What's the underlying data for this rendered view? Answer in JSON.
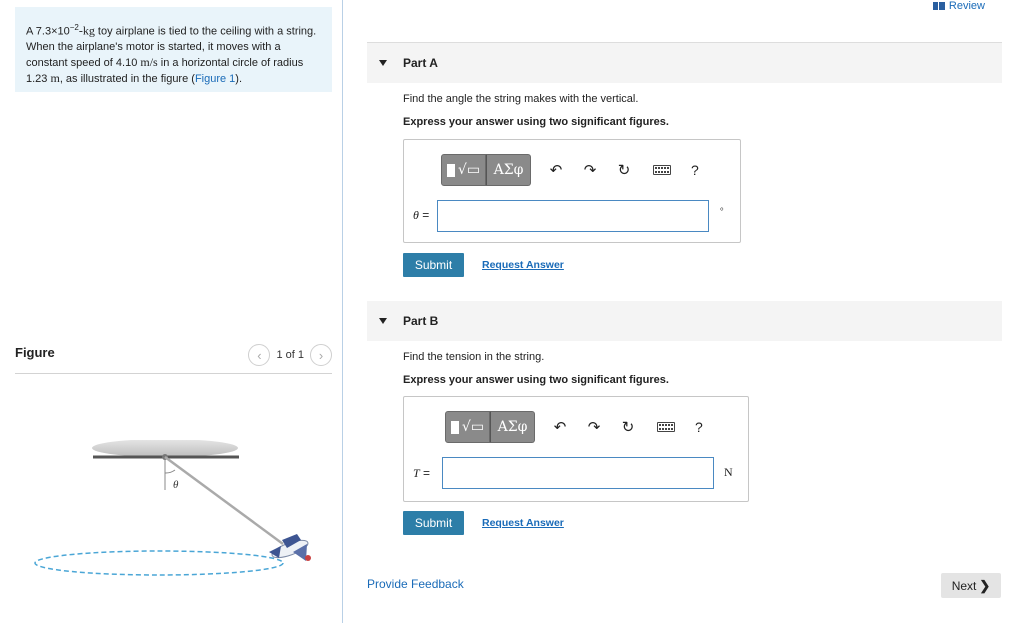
{
  "problem": {
    "t1": "A 7.3×10",
    "t_sup": "−2",
    "t_unit": "-kg",
    "t2": " toy airplane is tied to the ceiling with a string. When the airplane's motor is started, it moves with a constant speed of 4.10 ",
    "speed_unit": "m/s",
    "t3": " in a horizontal circle of radius 1.23 ",
    "radius_unit": "m",
    "t4": ", as illustrated in the figure (",
    "figure_link": "Figure 1",
    "t5": ")."
  },
  "figure": {
    "title": "Figure",
    "pager": "1 of 1",
    "prev_icon": "‹",
    "next_icon": "›",
    "angle_label": "θ"
  },
  "header": {
    "review_label": "Review"
  },
  "parts": [
    {
      "title": "Part A",
      "prompt": "Find the angle the string makes with the vertical.",
      "instruction": "Express your answer using two significant figures.",
      "var_symbol": "θ",
      "var_eq": " =",
      "input_value": "",
      "unit": "°",
      "submit_label": "Submit",
      "request_label": "Request Answer"
    },
    {
      "title": "Part B",
      "prompt": "Find the tension in the string.",
      "instruction": "Express your answer using two significant figures.",
      "var_symbol": "T",
      "var_eq": " =",
      "input_value": "",
      "unit": "N",
      "submit_label": "Submit",
      "request_label": "Request Answer"
    }
  ],
  "toolbar": {
    "template_icon": "√▭",
    "greek_label": "ΑΣφ",
    "undo_icon": "↶",
    "redo_icon": "↷",
    "reset_icon": "↻",
    "help_label": "?"
  },
  "footer": {
    "feedback_label": "Provide Feedback",
    "next_label": "Next",
    "next_icon": "❯"
  },
  "colors": {
    "accent": "#2d7ea8",
    "link": "#1a6bb8",
    "problem_bg": "#e9f4fa"
  }
}
